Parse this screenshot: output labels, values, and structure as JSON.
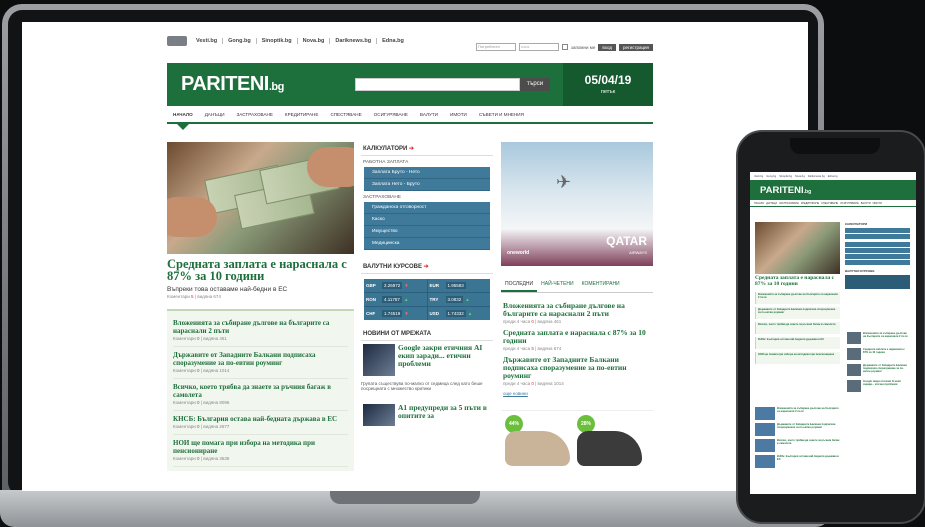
{
  "top_links": [
    "Vesti.bg",
    "Gong.bg",
    "Sinoptik.bg",
    "Nova.bg",
    "Dariknews.bg",
    "Edna.bg"
  ],
  "login": {
    "user_placeholder": "Потребител",
    "pass_placeholder": "••••••",
    "remember": "запомни ме",
    "login_btn": "вход",
    "register_btn": "регистрация"
  },
  "brand": {
    "name": "PARITENI",
    "tld": ".bg"
  },
  "search_btn": "търси",
  "date": {
    "value": "05/04/19",
    "day": "петък"
  },
  "nav": [
    "НАЧАЛО",
    "ДАНЪЦИ",
    "ЗАСТРАХОВАНЕ",
    "КРЕДИТИРАНЕ",
    "СПЕСТЯВАНЕ",
    "ОСИГУРЯВАНЕ",
    "ВАЛУТИ",
    "ИМОТИ",
    "СЪВЕТИ И МНЕНИЯ"
  ],
  "hero": {
    "title": "Средната заплата е нараснала с 87% за 10 години",
    "subtitle": "Въпреки това оставаме най-бедни в ЕС",
    "meta": "Коментари",
    "meta_count": "5",
    "views": "| видяна 674"
  },
  "list": [
    {
      "title": "Вложенията за събиране дългове на българите са нараснали 2 пъти",
      "meta": "Коментари",
      "count": "0",
      "views": "| видяна 461"
    },
    {
      "title": "Държавите от Западните Балкани подписаха споразумение за по-евтин роуминг",
      "meta": "Коментари",
      "count": "0",
      "views": "| видяна 1014"
    },
    {
      "title": "Всичко, което трябва да знаете за ръчния багаж в самолета",
      "meta": "Коментари",
      "count": "0",
      "views": "| видяна 8096"
    },
    {
      "title": "КНСБ: България остава най-бедната държава в ЕС",
      "meta": "Коментари",
      "count": "0",
      "views": "| видяна 2677"
    },
    {
      "title": "НОИ ще помага при избора на методика при пенсиониране",
      "meta": "Коментари",
      "count": "0",
      "views": "| видяна 3638"
    }
  ],
  "calc": {
    "title": "КАЛКУЛАТОРИ",
    "salary_h": "РАБОТНА ЗАПЛАТА",
    "salary": [
      "Заплата Бруто - Нето",
      "Заплата Нето - Бруто"
    ],
    "ins_h": "ЗАСТРАХОВАНЕ",
    "ins": [
      "Гражданска отговорност",
      "Каско",
      "Имущество",
      "Медицинска"
    ]
  },
  "rates": {
    "title": "ВАЛУТНИ КУРСОВЕ",
    "items": [
      {
        "cur": "GBP",
        "val": "2.26972",
        "dir": "down"
      },
      {
        "cur": "EUR",
        "val": "1.95583",
        "dir": "none"
      },
      {
        "cur": "RON",
        "val": "4.11787",
        "dir": "up"
      },
      {
        "cur": "TRY",
        "val": "3.0832",
        "dir": "up"
      },
      {
        "cur": "CHF",
        "val": "1.74519",
        "dir": "down"
      },
      {
        "cur": "USD",
        "val": "1.74332",
        "dir": "up"
      }
    ]
  },
  "network": {
    "title": "НОВИНИ ОТ МРЕЖАТА",
    "items": [
      {
        "title": "Google закри етичния AI екип заради... етични проблеми",
        "desc": "Групата съществува по-малко от седмица след като беше посрещната с множество критики"
      },
      {
        "title": "A1 предупреди за 5 пъти в опитите за",
        "desc": ""
      }
    ]
  },
  "ad": {
    "airline": "QATAR",
    "airline_sub": "AIRWAYS",
    "alliance": "oneworld"
  },
  "tabs": [
    "ПОСЛЕДНИ",
    "НАЙ-ЧЕТЕНИ",
    "КОМЕНТИРАНИ"
  ],
  "news": [
    {
      "title": "Вложенията за събиране дългове на българите са нараснали 2 пъти",
      "meta": "преди 4 часа",
      "count": "0",
      "views": "| видяна 461"
    },
    {
      "title": "Средната заплата е нараснала с 87% за 10 години",
      "meta": "преди 4 часа",
      "count": "5",
      "views": "| видяна 674"
    },
    {
      "title": "Държавите от Западните Балкани подписаха споразумение за по-евтин роуминг",
      "meta": "преди 4 часа",
      "count": "0",
      "views": "| видяна 1014"
    }
  ],
  "all_news": "още новини",
  "shoe_ads": [
    "44%",
    "28%"
  ],
  "phone": {
    "links": [
      "Vesti.bg",
      "Gong.bg",
      "Sinoptik.bg",
      "Nova.bg",
      "Darikcnews.bg",
      "Edna.bg"
    ],
    "hero_title": "Средната заплата е нараснала с 87% за 10 години"
  }
}
